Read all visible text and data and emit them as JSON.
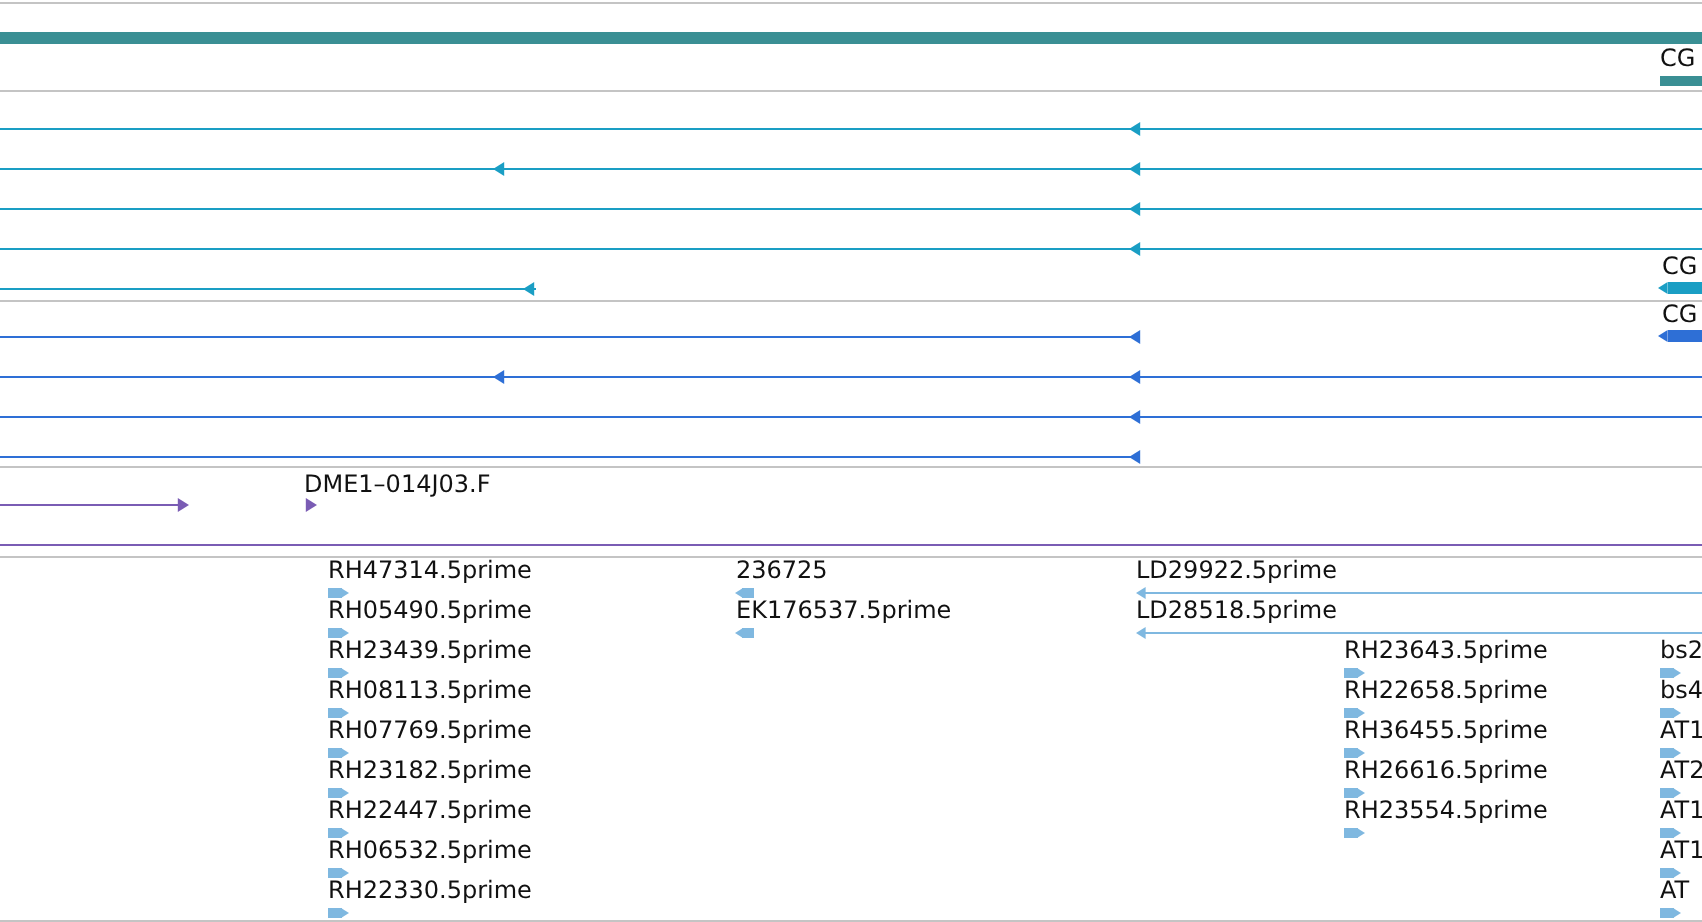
{
  "gene_track": {
    "label": "CG"
  },
  "transcript_tracks": [
    {
      "label": "CG",
      "transcripts": [
        {
          "reverse": true
        },
        {
          "reverse": true
        },
        {
          "reverse": true
        },
        {
          "reverse": true
        },
        {
          "reverse": true
        }
      ]
    },
    {
      "label": "CG",
      "transcripts": [
        {
          "reverse": true
        },
        {
          "reverse": true
        },
        {
          "reverse": true
        },
        {
          "reverse": true
        }
      ]
    }
  ],
  "clone_track": {
    "features": [
      {
        "reverse": false
      },
      {
        "label": "DME1–014J03.F",
        "reverse": false
      }
    ]
  },
  "est_track": {
    "features": [
      {
        "label": "RH47314.5prime",
        "reverse": false,
        "kind": "read"
      },
      {
        "label": "RH05490.5prime",
        "reverse": false,
        "kind": "read"
      },
      {
        "label": "RH23439.5prime",
        "reverse": false,
        "kind": "read"
      },
      {
        "label": "RH08113.5prime",
        "reverse": false,
        "kind": "read"
      },
      {
        "label": "RH07769.5prime",
        "reverse": false,
        "kind": "read"
      },
      {
        "label": "RH23182.5prime",
        "reverse": false,
        "kind": "read"
      },
      {
        "label": "RH22447.5prime",
        "reverse": false,
        "kind": "read"
      },
      {
        "label": "RH06532.5prime",
        "reverse": false,
        "kind": "read"
      },
      {
        "label": "RH22330.5prime",
        "reverse": false,
        "kind": "read"
      },
      {
        "label": "236725",
        "reverse": true,
        "kind": "read"
      },
      {
        "label": "EK176537.5prime",
        "reverse": true,
        "kind": "read"
      },
      {
        "label": "LD29922.5prime",
        "reverse": true,
        "kind": "span"
      },
      {
        "label": "LD28518.5prime",
        "reverse": true,
        "kind": "span"
      },
      {
        "label": "RH23643.5prime",
        "reverse": false,
        "kind": "read"
      },
      {
        "label": "RH22658.5prime",
        "reverse": false,
        "kind": "read"
      },
      {
        "label": "RH36455.5prime",
        "reverse": false,
        "kind": "read"
      },
      {
        "label": "RH26616.5prime",
        "reverse": false,
        "kind": "read"
      },
      {
        "label": "RH23554.5prime",
        "reverse": false,
        "kind": "read"
      },
      {
        "label": "bs2",
        "reverse": false,
        "kind": "read"
      },
      {
        "label": "bs4",
        "reverse": false,
        "kind": "read"
      },
      {
        "label": "AT1",
        "reverse": false,
        "kind": "read"
      },
      {
        "label": "AT2",
        "reverse": false,
        "kind": "read"
      },
      {
        "label": "AT1",
        "reverse": false,
        "kind": "read"
      },
      {
        "label": "AT1",
        "reverse": false,
        "kind": "read"
      },
      {
        "label": "AT",
        "reverse": false,
        "kind": "read"
      }
    ]
  }
}
